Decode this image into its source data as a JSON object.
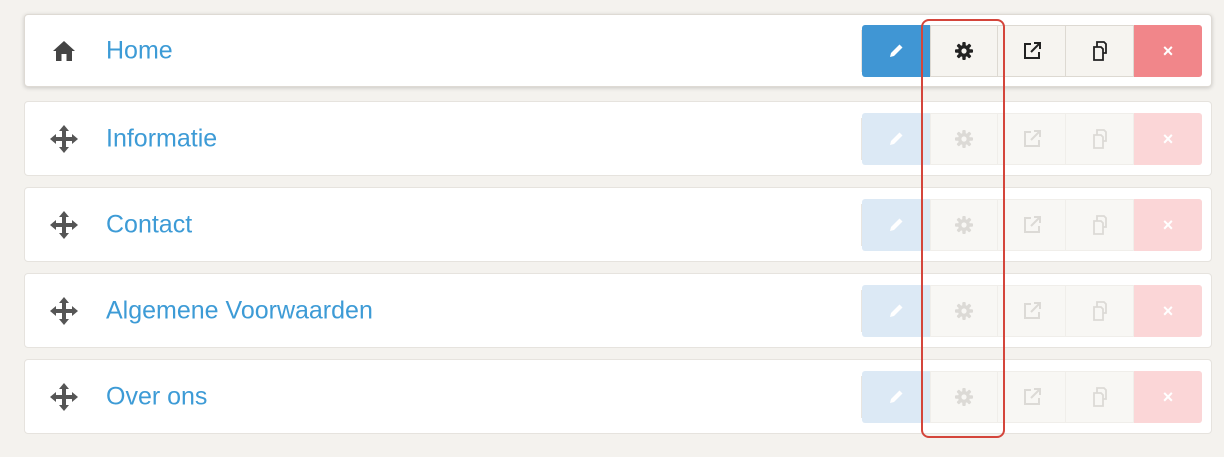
{
  "pages": [
    {
      "title": "Home",
      "icon": "home-icon",
      "active": true
    },
    {
      "title": "Informatie",
      "icon": "move-icon",
      "active": false
    },
    {
      "title": "Contact",
      "icon": "move-icon",
      "active": false
    },
    {
      "title": "Algemene Voorwaarden",
      "icon": "move-icon",
      "active": false
    },
    {
      "title": "Over ons",
      "icon": "move-icon",
      "active": false
    }
  ],
  "action_icons": [
    "pencil-icon",
    "gear-icon",
    "external-link-icon",
    "copy-icon",
    "close-icon"
  ],
  "delete_label": "×",
  "colors": {
    "title": "#3d9bd6",
    "edit": "#4096d4",
    "delete": "#f1868a",
    "highlight": "#d4453b"
  }
}
